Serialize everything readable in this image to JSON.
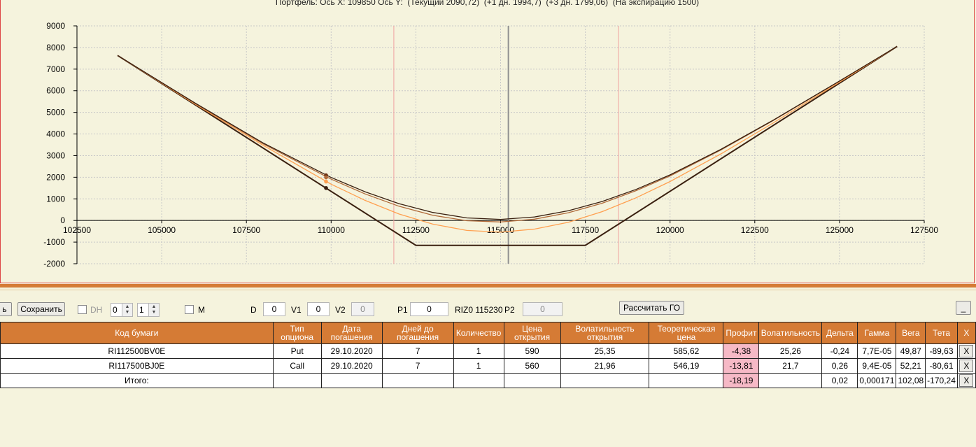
{
  "chart_title": "Портфель: Ось X: 109850 Ось Y:  (Текущий 2090,72)  (+1 дн. 1994,7)  (+3 дн. 1799,06)  (На экспирацию 1500)",
  "chart_data": {
    "type": "line",
    "title": "Портфель: Ось X: 109850 Ось Y:  (Текущий 2090,72)  (+1 дн. 1994,7)  (+3 дн. 1799,06)  (На экспирацию 1500)",
    "xlim": [
      102500,
      127500
    ],
    "ylim": [
      -2000,
      9000
    ],
    "x_ticks": [
      102500,
      105000,
      107500,
      110000,
      112500,
      115000,
      117500,
      120000,
      122500,
      125000,
      127500
    ],
    "y_ticks": [
      9000,
      8000,
      7000,
      6000,
      5000,
      4000,
      3000,
      2000,
      1000,
      0,
      -1000,
      -2000
    ],
    "grid": true,
    "vertical_lines": [
      {
        "x": 111850,
        "color": "#f0a0a0"
      },
      {
        "x": 115230,
        "color": "#909090"
      },
      {
        "x": 118480,
        "color": "#f0a0a0"
      }
    ],
    "series": [
      {
        "color": "#3a2010",
        "points": [
          [
            103700,
            7630
          ],
          [
            112500,
            -1150
          ],
          [
            117500,
            -1150
          ],
          [
            126700,
            8050
          ]
        ]
      },
      {
        "color": "#ffa050",
        "points": [
          [
            103700,
            7630
          ],
          [
            106000,
            5370
          ],
          [
            108000,
            3470
          ],
          [
            110000,
            1680
          ],
          [
            111000,
            930
          ],
          [
            112000,
            300
          ],
          [
            113000,
            -170
          ],
          [
            114000,
            -460
          ],
          [
            115000,
            -540
          ],
          [
            116000,
            -400
          ],
          [
            117000,
            -80
          ],
          [
            118000,
            410
          ],
          [
            119000,
            1050
          ],
          [
            120000,
            1800
          ],
          [
            121500,
            3080
          ],
          [
            123000,
            4470
          ],
          [
            125000,
            6400
          ],
          [
            126700,
            8050
          ]
        ]
      },
      {
        "color": "#b06a3a",
        "points": [
          [
            103700,
            7630
          ],
          [
            106000,
            5400
          ],
          [
            108000,
            3540
          ],
          [
            110000,
            1910
          ],
          [
            111000,
            1230
          ],
          [
            112000,
            660
          ],
          [
            113000,
            240
          ],
          [
            114000,
            -10
          ],
          [
            115000,
            -70
          ],
          [
            116000,
            60
          ],
          [
            117000,
            360
          ],
          [
            118000,
            800
          ],
          [
            119000,
            1380
          ],
          [
            120000,
            2060
          ],
          [
            121500,
            3260
          ],
          [
            123000,
            4580
          ],
          [
            125000,
            6440
          ],
          [
            126700,
            8050
          ]
        ]
      },
      {
        "color": "#3a2010",
        "points": [
          [
            103700,
            7630
          ],
          [
            106000,
            5420
          ],
          [
            108000,
            3580
          ],
          [
            110000,
            1990
          ],
          [
            111000,
            1330
          ],
          [
            112000,
            780
          ],
          [
            113000,
            370
          ],
          [
            114000,
            120
          ],
          [
            115000,
            50
          ],
          [
            116000,
            160
          ],
          [
            117000,
            450
          ],
          [
            118000,
            880
          ],
          [
            119000,
            1440
          ],
          [
            120000,
            2110
          ],
          [
            121500,
            3290
          ],
          [
            123000,
            4600
          ],
          [
            125000,
            6450
          ],
          [
            126700,
            8050
          ]
        ]
      }
    ],
    "markers": [
      {
        "x": 109850,
        "y": 2090.72,
        "color": "#6a2f10"
      },
      {
        "x": 109850,
        "y": 1994.7,
        "color": "#b06a3a"
      },
      {
        "x": 109850,
        "y": 1799.06,
        "color": "#ffa050"
      },
      {
        "x": 109850,
        "y": 1500,
        "color": "#3a2010"
      }
    ]
  },
  "toolbar": {
    "left_btn": "ь",
    "save_btn": "Сохранить",
    "dh_label": "DH",
    "spin1_value": "0",
    "spin2_value": "1",
    "m_label": "M",
    "d_label": "D",
    "d_value": "0",
    "v1_label": "V1",
    "v1_value": "0",
    "v2_label": "V2",
    "v2_value": "0",
    "p1_label": "P1",
    "p1_value": "0",
    "riz_label": "RIZ0 115230",
    "p2_label": "P2",
    "p2_value": "0",
    "calc_btn": "Рассчитать ГО",
    "min_btn": "_"
  },
  "table": {
    "headers": [
      "Код бумаги",
      "Тип опциона",
      "Дата погашения",
      "Дней до погашения",
      "Количество",
      "Цена открытия",
      "Волатильность открытия",
      "Теоретическая цена",
      "Профит",
      "Волатильность",
      "Дельта",
      "Гамма",
      "Вега",
      "Тета",
      "X"
    ],
    "rows": [
      [
        "RI112500BV0E",
        "Put",
        "29.10.2020",
        "7",
        "1",
        "590",
        "25,35",
        "585,62",
        "-4,38",
        "25,26",
        "-0,24",
        "7,7E-05",
        "49,87",
        "-89,63",
        "X"
      ],
      [
        "RI117500BJ0E",
        "Call",
        "29.10.2020",
        "7",
        "1",
        "560",
        "21,96",
        "546,19",
        "-13,81",
        "21,7",
        "0,26",
        "9,4E-05",
        "52,21",
        "-80,61",
        "X"
      ],
      [
        "Итого:",
        "",
        "",
        "",
        "",
        "",
        "",
        "",
        "-18,19",
        "",
        "0,02",
        "0,000171",
        "102,08",
        "-170,24",
        "X"
      ]
    ]
  }
}
